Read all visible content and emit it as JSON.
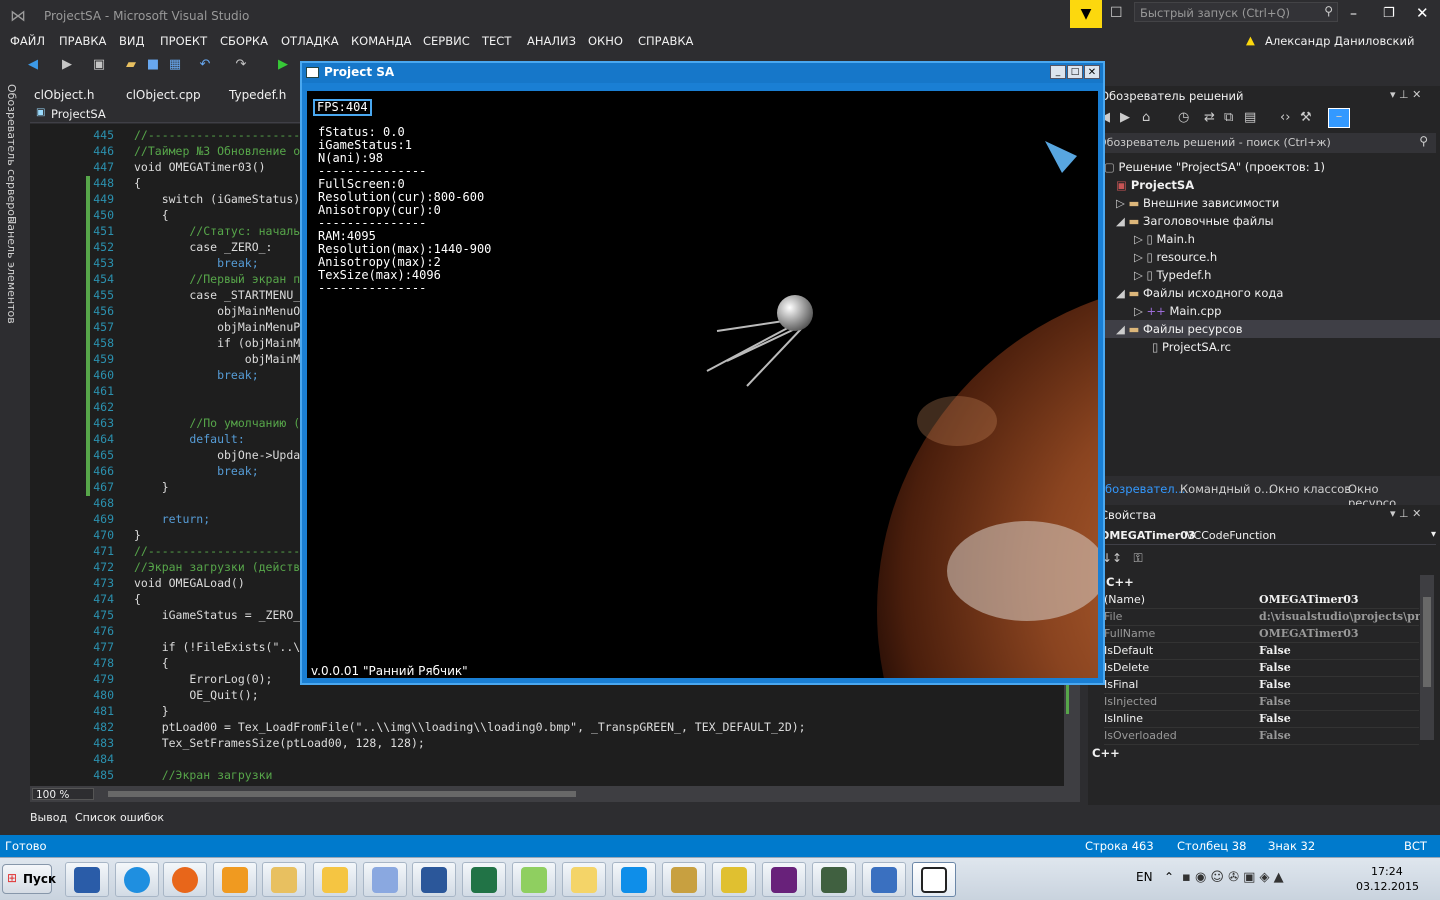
{
  "titlebar": {
    "title": "ProjectSA - Microsoft Visual Studio",
    "quicklaunch_placeholder": "Быстрый запуск (Ctrl+Q)",
    "user": "Александр Даниловский"
  },
  "menu": [
    "ФАЙЛ",
    "ПРАВКА",
    "ВИД",
    "ПРОЕКТ",
    "СБОРКА",
    "ОТЛАДКА",
    "КОМАНДА",
    "СЕРВИС",
    "ТЕСТ",
    "АНАЛИЗ",
    "ОКНО",
    "СПРАВКА"
  ],
  "sidebar_labels": {
    "server_explorer": "Обозреватель серверов",
    "toolbox": "Панель элементов"
  },
  "doc_tabs": [
    "clObject.h",
    "clObject.cpp",
    "Typedef.h"
  ],
  "editor_project": "ProjectSA",
  "code_lines": [
    {
      "n": "445",
      "t": "//-----------------------------------------------------",
      "c": "cm"
    },
    {
      "n": "446",
      "t": "//Таймер №3 Обновление объектов",
      "c": "cm"
    },
    {
      "n": "447",
      "t": "void OMEGATimer03()",
      "c": ""
    },
    {
      "n": "448",
      "t": "{",
      "c": ""
    },
    {
      "n": "449",
      "t": "    switch (iGameStatus)",
      "c": ""
    },
    {
      "n": "450",
      "t": "    {",
      "c": ""
    },
    {
      "n": "451",
      "t": "        //Статус: начальная",
      "c": "cm"
    },
    {
      "n": "452",
      "t": "        case _ZERO_:",
      "c": ""
    },
    {
      "n": "453",
      "t": "            break;",
      "c": "kw"
    },
    {
      "n": "454",
      "t": "        //Первый экран после",
      "c": "cm"
    },
    {
      "n": "455",
      "t": "        case _STARTMENU_:",
      "c": ""
    },
    {
      "n": "456",
      "t": "            objMainMenuObject",
      "c": ""
    },
    {
      "n": "457",
      "t": "            objMainMenuPlanet",
      "c": ""
    },
    {
      "n": "458",
      "t": "            if (objMainMenuP",
      "c": ""
    },
    {
      "n": "459",
      "t": "                objMainMenuP",
      "c": ""
    },
    {
      "n": "460",
      "t": "            break;",
      "c": "kw"
    },
    {
      "n": "461",
      "t": "",
      "c": ""
    },
    {
      "n": "462",
      "t": "",
      "c": ""
    },
    {
      "n": "463",
      "t": "        //По умолчанию (тест",
      "c": "cm"
    },
    {
      "n": "464",
      "t": "        default:",
      "c": "kw"
    },
    {
      "n": "465",
      "t": "            objOne->Update()",
      "c": ""
    },
    {
      "n": "466",
      "t": "            break;",
      "c": "kw"
    },
    {
      "n": "467",
      "t": "    }",
      "c": ""
    },
    {
      "n": "468",
      "t": "",
      "c": ""
    },
    {
      "n": "469",
      "t": "    return;",
      "c": "kw"
    },
    {
      "n": "470",
      "t": "}",
      "c": ""
    },
    {
      "n": "471",
      "t": "//-----------------------------------------------------",
      "c": "cm"
    },
    {
      "n": "472",
      "t": "//Экран загрузки (действия,",
      "c": "cm"
    },
    {
      "n": "473",
      "t": "void OMEGALoad()",
      "c": ""
    },
    {
      "n": "474",
      "t": "{",
      "c": ""
    },
    {
      "n": "475",
      "t": "    iGameStatus = _ZERO_;",
      "c": ""
    },
    {
      "n": "476",
      "t": "",
      "c": ""
    },
    {
      "n": "477",
      "t": "    if (!FileExists(\"..\\\\img",
      "c": ""
    },
    {
      "n": "478",
      "t": "    {",
      "c": ""
    },
    {
      "n": "479",
      "t": "        ErrorLog(0);",
      "c": ""
    },
    {
      "n": "480",
      "t": "        OE_Quit();",
      "c": ""
    },
    {
      "n": "481",
      "t": "    }",
      "c": ""
    },
    {
      "n": "482",
      "t": "    ptLoad00 = Tex_LoadFromFile(\"..\\\\img\\\\loading\\\\loading0.bmp\", _TranspGREEN_, TEX_DEFAULT_2D);",
      "c": ""
    },
    {
      "n": "483",
      "t": "    Tex_SetFramesSize(ptLoad00, 128, 128);",
      "c": ""
    },
    {
      "n": "484",
      "t": "",
      "c": ""
    },
    {
      "n": "485",
      "t": "    //Экран загрузки",
      "c": "cm"
    }
  ],
  "zoom": "100 %",
  "bottom_tabs": [
    "Вывод",
    "Список ошибок"
  ],
  "status": {
    "ready": "Готово",
    "line": "Строка 463",
    "col": "Столбец 38",
    "char": "Знак 32",
    "mode": "ВСТ"
  },
  "solution": {
    "header": "Обозреватель решений",
    "search": "Обозреватель решений - поиск (Ctrl+ж)",
    "items": [
      "Решение \"ProjectSA\" (проектов: 1)",
      "ProjectSA",
      "Внешние зависимости",
      "Заголовочные файлы",
      "Main.h",
      "resource.h",
      "Typedef.h",
      "Файлы исходного кода",
      "Main.cpp",
      "Файлы ресурсов",
      "ProjectSA.rc"
    ]
  },
  "right_tabs": [
    "Обозревател...",
    "Командный о...",
    "Окно классов",
    "Окно ресурсо..."
  ],
  "properties": {
    "header": "Свойства",
    "object": "OMEGATimer03",
    "object_type": "VCCodeFunction",
    "category": "C++",
    "rows": [
      [
        "(Name)",
        "OMEGATimer03"
      ],
      [
        "File",
        "d:\\visualstudio\\projects\\pr"
      ],
      [
        "FullName",
        "OMEGATimer03"
      ],
      [
        "IsDefault",
        "False"
      ],
      [
        "IsDelete",
        "False"
      ],
      [
        "IsFinal",
        "False"
      ],
      [
        "IsInjected",
        "False"
      ],
      [
        "IsInline",
        "False"
      ],
      [
        "IsOverloaded",
        "False"
      ]
    ],
    "footer": "C++"
  },
  "game": {
    "title": "Project SA",
    "fps": "FPS:404",
    "debug": "fStatus: 0.0\niGameStatus:1\nN(ani):98\n---------------\nFullScreen:0\nResolution(cur):800-600\nAnisotropy(cur):0\n---------------\nRAM:4095\nResolution(max):1440-900\nAnisotropy(max):2\nTexSize(max):4096\n---------------",
    "version": "v.0.0.01 \"Ранний Рябчик\""
  },
  "taskbar": {
    "start": "Пуск",
    "lang": "EN",
    "time": "17:24",
    "date": "03.12.2015"
  }
}
